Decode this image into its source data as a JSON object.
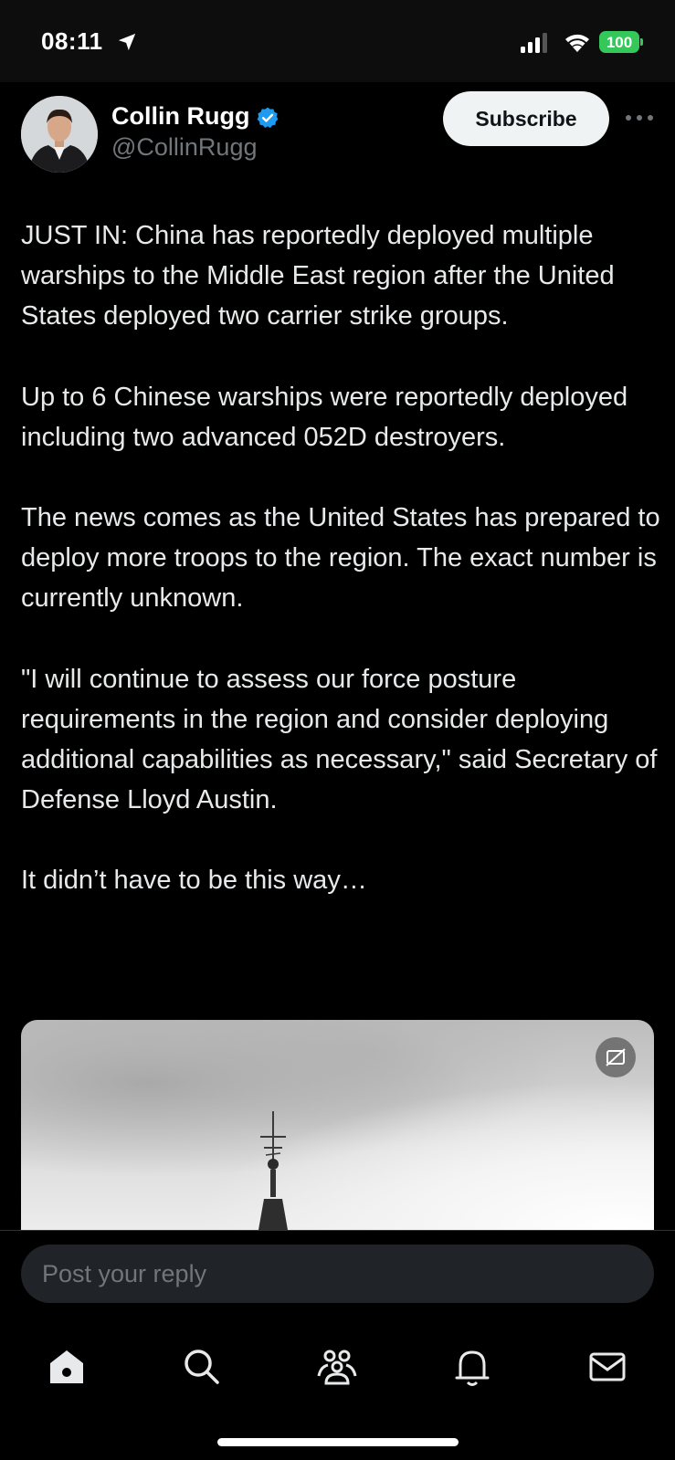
{
  "status_bar": {
    "time": "08:11",
    "battery": "100",
    "icons": [
      "location-arrow-icon",
      "signal-icon",
      "wifi-icon",
      "battery-icon"
    ],
    "colors": {
      "battery": "#34c759"
    }
  },
  "author": {
    "name": "Collin Rugg",
    "handle": "@CollinRugg",
    "verified": true,
    "subscribe_label": "Subscribe",
    "colors": {
      "verified_badge": "#1d9bf0"
    }
  },
  "tweet": {
    "paragraphs": [
      "JUST IN: China has reportedly deployed multiple warships to the Middle East region after the United States deployed two carrier strike groups.",
      "Up to 6 Chinese warships were reportedly deployed including two advanced 052D destroyers.",
      "The news comes as the United States has prepared to deploy more troops to the region. The exact number is currently unknown.",
      "\"I will continue to assess our force posture requirements in the region and consider deploying additional capabilities as necessary,\" said Secretary of Defense Lloyd Austin.",
      "It didn’t have to be this way…"
    ]
  },
  "reply": {
    "placeholder": "Post your reply"
  },
  "tab_bar": {
    "items": [
      "home-icon",
      "search-icon",
      "communities-icon",
      "notifications-icon",
      "messages-icon"
    ]
  }
}
